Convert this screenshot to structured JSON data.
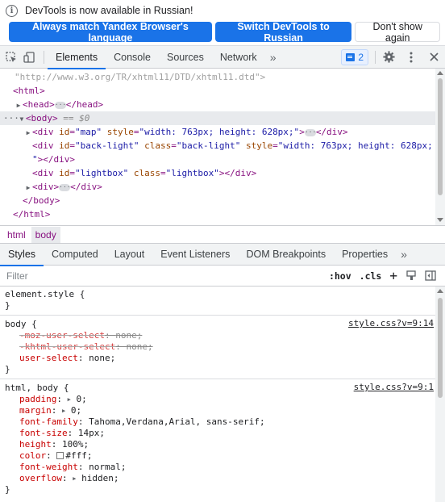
{
  "infobar": {
    "message": "DevTools is now available in Russian!",
    "btn_match": "Always match Yandex Browser's language",
    "btn_switch": "Switch DevTools to Russian",
    "btn_dismiss": "Don't show again"
  },
  "toolbar": {
    "tabs": [
      "Elements",
      "Console",
      "Sources",
      "Network"
    ],
    "more": "»",
    "issues_count": "2"
  },
  "dom": {
    "doctype": "\"http://www.w3.org/TR/xhtml11/DTD/xhtml11.dtd\">",
    "html_open": "<html>",
    "head": "<head>",
    "head_close": "</head>",
    "body": "<body>",
    "body_marker": "== $0",
    "div_map_attr_id": "id",
    "div_map_id": "\"map\"",
    "div_map_attr_style": "style",
    "div_map_style": "\"width: 763px; height: 628px;\"",
    "backlight_id": "\"back-light\"",
    "backlight_class": "\"back-light\"",
    "backlight_style": "\"width: 763px; height: 628px;",
    "backlight_close": "\"></div>",
    "lightbox_id": "\"lightbox\"",
    "lightbox_class": "\"lightbox\"",
    "div_close": "</div>",
    "body_close": "</body>",
    "html_close": "</html>"
  },
  "breadcrumbs": [
    "html",
    "body"
  ],
  "styles_tabs": [
    "Styles",
    "Computed",
    "Layout",
    "Event Listeners",
    "DOM Breakpoints",
    "Properties"
  ],
  "styles_more": "»",
  "filter": {
    "placeholder": "Filter",
    "hov": ":hov",
    "cls": ".cls",
    "plus": "+"
  },
  "rules": {
    "element_style": {
      "selector": "element.style {",
      "close": "}"
    },
    "body_rule": {
      "selector": "body {",
      "source": "style.css?v=9:14",
      "props": [
        {
          "name": "-moz-user-select",
          "value": "none;",
          "struck": true
        },
        {
          "name": "-khtml-user-select",
          "value": "none;",
          "struck": true
        },
        {
          "name": "user-select",
          "value": "none;",
          "struck": false
        }
      ],
      "close": "}"
    },
    "html_body_rule": {
      "selector": "html, body {",
      "source": "style.css?v=9:1",
      "props": [
        {
          "name": "padding",
          "value": "0;",
          "expand": true
        },
        {
          "name": "margin",
          "value": "0;",
          "expand": true
        },
        {
          "name": "font-family",
          "value": "Tahoma,Verdana,Arial, sans-serif;"
        },
        {
          "name": "font-size",
          "value": "14px;"
        },
        {
          "name": "height",
          "value": "100%;"
        },
        {
          "name": "color",
          "value": "#fff;",
          "swatch": "#ffffff"
        },
        {
          "name": "font-weight",
          "value": "normal;"
        },
        {
          "name": "overflow",
          "value": "hidden;",
          "expand": true
        }
      ],
      "close": "}"
    }
  },
  "colors": {
    "accent": "#1a73e8",
    "tag": "#881280",
    "attr_name": "#994500",
    "attr_value": "#1a1aa6",
    "prop": "#c80000"
  }
}
